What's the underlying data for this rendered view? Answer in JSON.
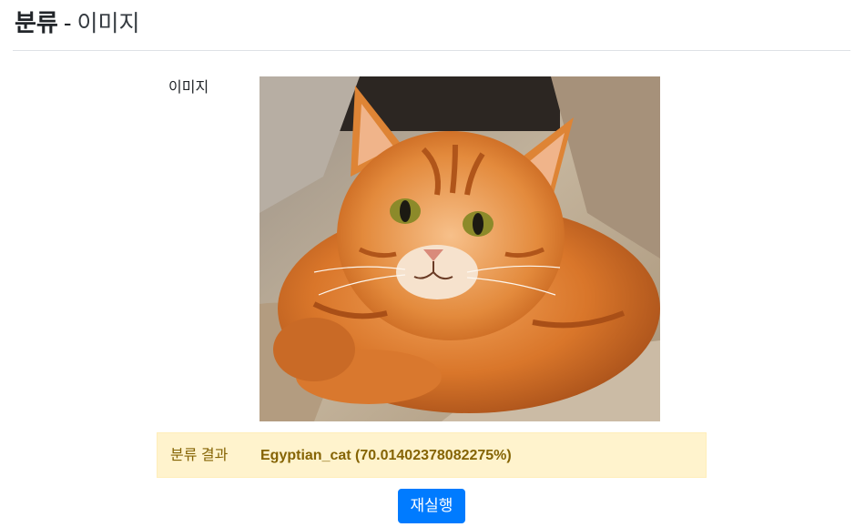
{
  "header": {
    "title_main": "분류",
    "separator": "-",
    "title_sub": "이미지"
  },
  "form": {
    "image_label": "이미지",
    "image_alt": "orange tabby cat"
  },
  "result": {
    "label": "분류 결과",
    "value": "Egyptian_cat (70.01402378082275%)"
  },
  "actions": {
    "rerun_label": "재실행"
  },
  "colors": {
    "primary": "#007bff",
    "result_bg": "#fff3cd",
    "result_text": "#856404"
  }
}
